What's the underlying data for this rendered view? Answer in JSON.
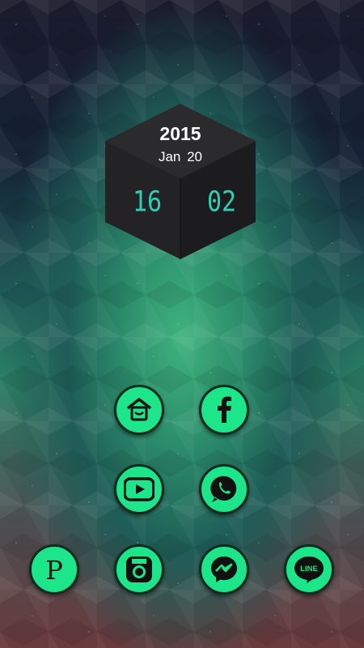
{
  "clock": {
    "year": "2015",
    "date": "Jan  20",
    "hour": "16",
    "minute": "02"
  },
  "icons": [
    {
      "name": "home-launcher-icon"
    },
    {
      "name": "facebook-icon"
    },
    {
      "name": "youtube-icon"
    },
    {
      "name": "whatsapp-icon"
    },
    {
      "name": "pinterest-icon",
      "glyph": "P"
    },
    {
      "name": "instagram-icon"
    },
    {
      "name": "messenger-icon"
    },
    {
      "name": "line-icon",
      "glyph": "LINE"
    }
  ],
  "colors": {
    "icon_background": "#1de58a",
    "clock_digits": "#2ecfb6"
  }
}
